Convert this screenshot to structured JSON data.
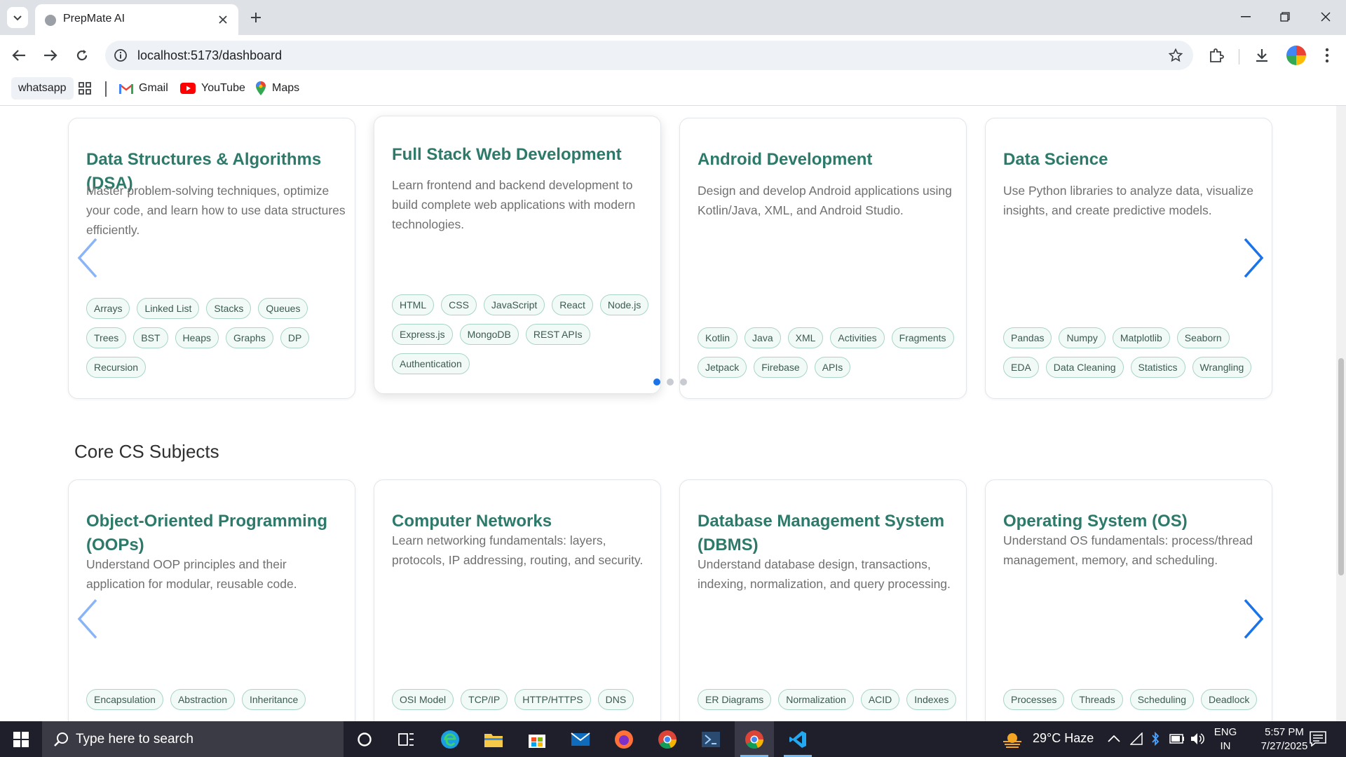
{
  "browser": {
    "tab_title": "PrepMate AI",
    "url": "localhost:5173/dashboard",
    "bookmarks": [
      {
        "label": "whatsapp",
        "icon": "none"
      },
      {
        "label": "",
        "icon": "apps-grid-icon"
      },
      {
        "label": "Gmail",
        "icon": "gmail-icon"
      },
      {
        "label": "YouTube",
        "icon": "youtube-icon"
      },
      {
        "label": "Maps",
        "icon": "maps-icon"
      }
    ]
  },
  "top_cards": [
    {
      "title": "Data Structures & Algorithms (DSA)",
      "description": "Master problem-solving techniques, optimize your code, and learn how to use data structures efficiently.",
      "tags": [
        "Arrays",
        "Linked List",
        "Stacks",
        "Queues",
        "Trees",
        "BST",
        "Heaps",
        "Graphs",
        "DP",
        "Recursion"
      ]
    },
    {
      "title": "Full Stack Web Development",
      "description": "Learn frontend and backend development to build complete web applications with modern technologies.",
      "tags": [
        "HTML",
        "CSS",
        "JavaScript",
        "React",
        "Node.js",
        "Express.js",
        "MongoDB",
        "REST APIs",
        "Authentication"
      ]
    },
    {
      "title": "Android Development",
      "description": "Design and develop Android applications using Kotlin/Java, XML, and Android Studio.",
      "tags": [
        "Kotlin",
        "Java",
        "XML",
        "Activities",
        "Fragments",
        "Jetpack",
        "Firebase",
        "APIs"
      ]
    },
    {
      "title": "Data Science",
      "description": "Use Python libraries to analyze data, visualize insights, and create predictive models.",
      "tags": [
        "Pandas",
        "Numpy",
        "Matplotlib",
        "Seaborn",
        "EDA",
        "Data Cleaning",
        "Statistics",
        "Wrangling"
      ]
    }
  ],
  "carousel_dots": {
    "count": 3,
    "active_index": 0
  },
  "core_section": {
    "heading": "Core CS Subjects",
    "cards": [
      {
        "title": "Object-Oriented Programming (OOPs)",
        "description": "Understand OOP principles and their application for modular, reusable code.",
        "tags": [
          "Encapsulation",
          "Abstraction",
          "Inheritance"
        ]
      },
      {
        "title": "Computer Networks",
        "description": "Learn networking fundamentals: layers, protocols, IP addressing, routing, and security.",
        "tags": [
          "OSI Model",
          "TCP/IP",
          "HTTP/HTTPS",
          "DNS"
        ]
      },
      {
        "title": "Database Management System (DBMS)",
        "description": "Understand database design, transactions, indexing, normalization, and query processing.",
        "tags": [
          "ER Diagrams",
          "Normalization",
          "ACID",
          "Indexes"
        ]
      },
      {
        "title": "Operating System (OS)",
        "description": "Understand OS fundamentals: process/thread management, memory, and scheduling.",
        "tags": [
          "Processes",
          "Threads",
          "Scheduling",
          "Deadlock"
        ]
      }
    ]
  },
  "taskbar": {
    "search_placeholder": "Type here to search",
    "weather": "29°C  Haze",
    "language_top": "ENG",
    "language_bottom": "IN",
    "time": "5:57 PM",
    "date": "7/27/2025"
  },
  "colors": {
    "accent": "#2d7a6a",
    "tag_border": "#a9d5c8",
    "tag_bg": "#f1faf6",
    "arrow": "#1a73e8",
    "arrow_disabled": "#8ab4f8",
    "dot_active": "#1a73e8"
  }
}
